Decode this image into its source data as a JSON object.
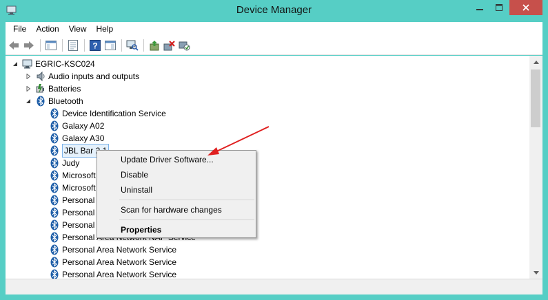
{
  "window": {
    "title": "Device Manager"
  },
  "menu": [
    "File",
    "Action",
    "View",
    "Help"
  ],
  "tree": {
    "root": "EGRIC-KSC024",
    "categories": [
      {
        "label": "Audio inputs and outputs"
      },
      {
        "label": "Batteries"
      },
      {
        "label": "Bluetooth"
      }
    ],
    "bluetooth_devices": [
      "Device Identification Service",
      "Galaxy A02",
      "Galaxy A30",
      "JBL Bar 2.1",
      "Judy",
      "Microsoft",
      "Microsoft",
      "Personal",
      "Personal",
      "Personal",
      "Personal Area Network NAP Service",
      "Personal Area Network Service",
      "Personal Area Network Service",
      "Personal Area Network Service"
    ]
  },
  "context_menu": {
    "update": "Update Driver Software...",
    "disable": "Disable",
    "uninstall": "Uninstall",
    "scan": "Scan for hardware changes",
    "properties": "Properties"
  },
  "colors": {
    "frame": "#56cec5",
    "close": "#c7504b",
    "bluetooth": "#1e5ea8",
    "arrow": "#e02020"
  }
}
